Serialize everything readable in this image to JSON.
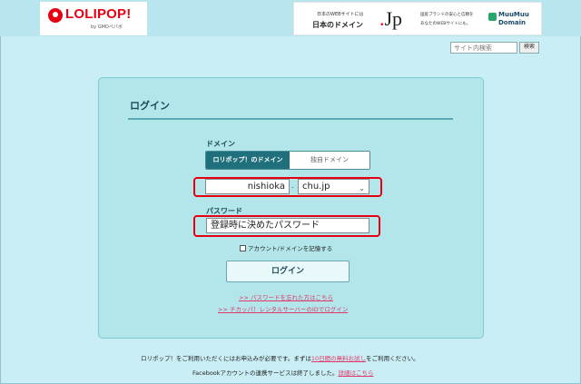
{
  "header": {
    "logo_text": "LOLIPOP!",
    "logo_sub": "by GMOペパボ",
    "banner": {
      "line1": "日本のWEBサイトには",
      "line2": "日本のドメイン",
      "jp_dot": ".",
      "jp_text": "Jp",
      "right_line1": "国産ブランドの安心と信頼を",
      "right_line2": "あなたのWEBサイトにも。",
      "brand_line1": "MuuMuu",
      "brand_line2": "Domain"
    },
    "search_placeholder": "サイト内検索",
    "search_button": "検索"
  },
  "login": {
    "title": "ログイン",
    "domain_label": "ドメイン",
    "tab_lolipop": "ロリポップ！のドメイン",
    "tab_own": "独自ドメイン",
    "subdomain_value": "nishioka",
    "domain_dot": ".",
    "domain_select_value": "chu.jp",
    "password_label": "パスワード",
    "password_value": "登録時に決めたパスワード",
    "remember_label": "アカウント/ドメインを記憶する",
    "login_button": "ログイン",
    "link_forgot": ">> パスワードを忘れた方はこちら",
    "link_chicappa": ">> チカッパ！レンタルサーバーのIDでログイン"
  },
  "footer": {
    "line1_pre": "ロリポップ！をご利用いただくにはお申込みが必要です。まずは",
    "line1_link": "10日間の無料お試し",
    "line1_post": "をご利用ください。",
    "line2_pre": "Facebookアカウントの連携サービスは終了しました。",
    "line2_link": "詳細はこちら"
  },
  "colors": {
    "background": "#c9eef5",
    "panel": "#b2e6ea",
    "tab_active": "#1f6f7c",
    "highlight": "#e60012",
    "link": "#e03a6a"
  }
}
